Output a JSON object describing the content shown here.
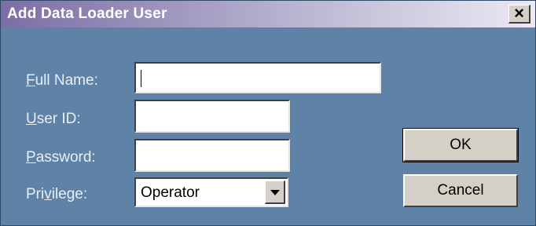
{
  "dialog": {
    "title": "Add Data Loader User",
    "close_label": "×"
  },
  "form": {
    "full_name": {
      "label_mnemonic": "F",
      "label_rest": "ull Name:",
      "value": ""
    },
    "user_id": {
      "label_mnemonic": "U",
      "label_rest": "ser ID:",
      "value": ""
    },
    "password": {
      "label_mnemonic": "P",
      "label_rest": "assword:",
      "value": ""
    },
    "privilege": {
      "label_before": "Pri",
      "label_mnemonic": "v",
      "label_after": "ilege:",
      "selected": "Operator"
    }
  },
  "buttons": {
    "ok_label": "OK",
    "cancel_label": "Cancel"
  },
  "colors": {
    "dialog_background": "#5f82a7",
    "titlebar_start": "#7b6ea6",
    "button_face": "#d4d0c8"
  }
}
